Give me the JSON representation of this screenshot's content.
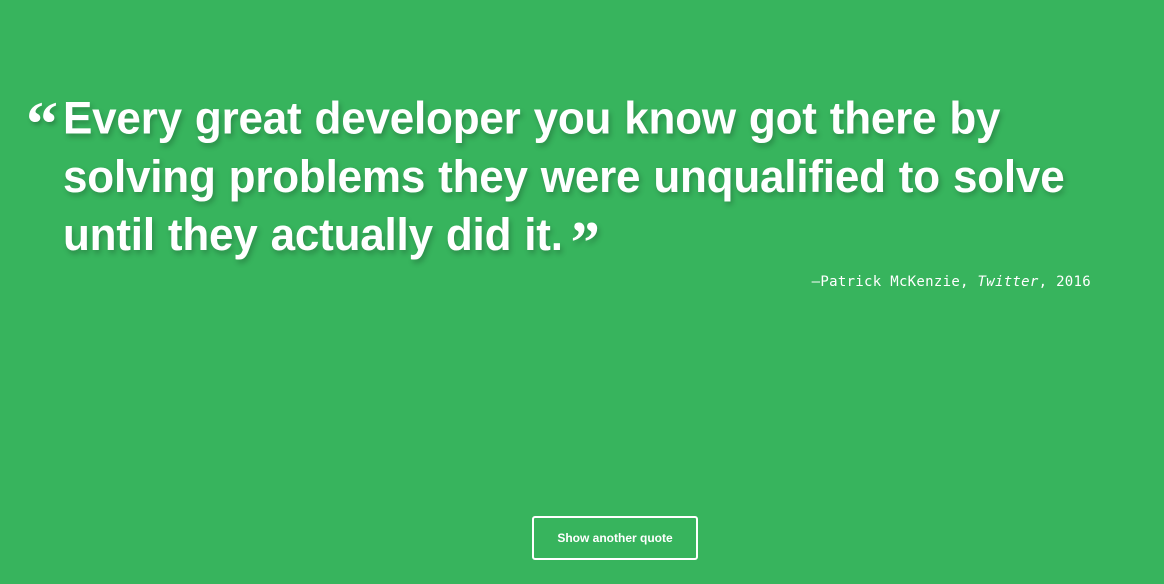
{
  "theme": {
    "background": "#37b45d",
    "text": "#ffffff"
  },
  "quote": {
    "open_mark": "“",
    "text": "Every great developer you know got there by solving problems they were unqualified to solve until they actually did it.",
    "close_mark": "”"
  },
  "attribution": {
    "prefix": "—Patrick McKenzie,",
    "source": "Twitter",
    "year": ", 2016"
  },
  "actions": {
    "next_quote_label": "Show another quote"
  }
}
